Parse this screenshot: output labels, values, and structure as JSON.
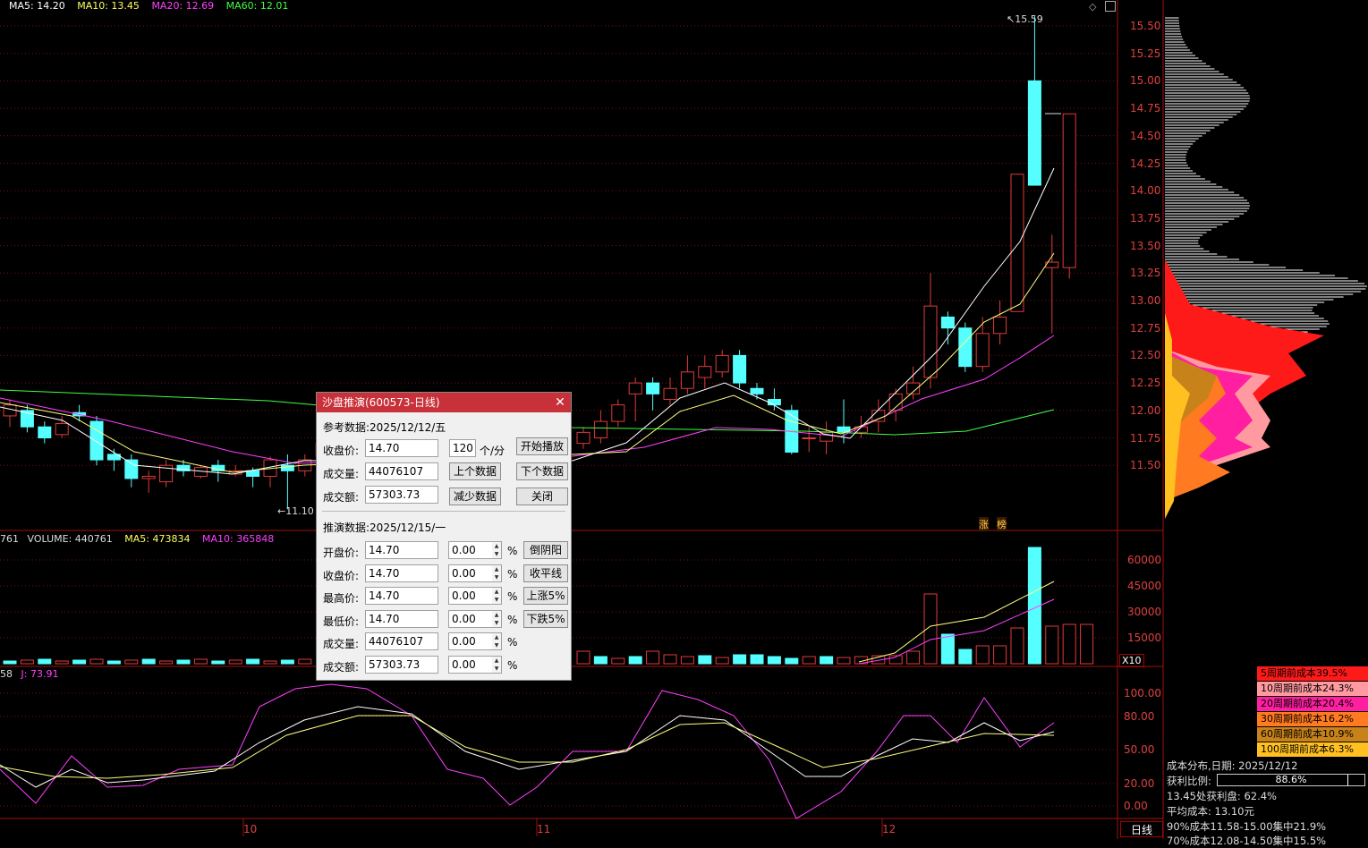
{
  "main_legend": {
    "ma5": "MA5: 14.20",
    "ma10": "MA10: 13.45",
    "ma20": "MA20: 12.69",
    "ma60": "MA60: 12.01"
  },
  "volume_legend": {
    "prefix": "761",
    "volume": "VOLUME: 440761",
    "ma5": "MA5: 473834",
    "ma10": "MA10: 365848"
  },
  "kdj_legend": {
    "prefix": "58",
    "j": "J: 73.91"
  },
  "price_axis": [
    "15.50",
    "15.25",
    "15.00",
    "14.75",
    "14.50",
    "14.25",
    "14.00",
    "13.75",
    "13.50",
    "13.25",
    "13.00",
    "12.75",
    "12.50",
    "12.25",
    "12.00",
    "11.75",
    "11.50"
  ],
  "volume_axis": [
    "60000",
    "45000",
    "30000",
    "15000"
  ],
  "volume_multiplier": "X10",
  "kdj_axis": [
    "100.00",
    "80.00",
    "50.00",
    "20.00",
    "0.00"
  ],
  "month_labels": [
    "10",
    "11",
    "12"
  ],
  "high_marker": "15.59",
  "low_marker": "11.10",
  "tags": [
    "涨",
    "榜"
  ],
  "period_tab": "日线",
  "cost_legend": [
    {
      "label": "5周期前成本39.5%",
      "color": "#ff1a1a"
    },
    {
      "label": "10周期前成本24.3%",
      "color": "#ff9aa0"
    },
    {
      "label": "20周期前成本20.4%",
      "color": "#ff1fa0"
    },
    {
      "label": "30周期前成本16.2%",
      "color": "#ff7a20"
    },
    {
      "label": "60周期前成本10.9%",
      "color": "#c8821a"
    },
    {
      "label": "100周期前成本6.3%",
      "color": "#ffc020"
    }
  ],
  "cost_info": {
    "title": "成本分布,日期: 2025/12/12",
    "profit_label": "获利比例:",
    "profit_value": "88.6%",
    "profit_fraction": 0.886,
    "at_price": "13.45处获利盘: 62.4%",
    "avg_cost": "平均成本: 13.10元",
    "c90": "90%成本11.58-15.00集中21.9%",
    "c70": "70%成本12.08-14.50集中15.5%"
  },
  "dialog": {
    "title": "沙盘推演(600573-日线)",
    "ref_title": "参考数据:2025/12/12/五",
    "close_label": "收盘价:",
    "close_value": "14.70",
    "speed_value": "120",
    "speed_unit": "个/分",
    "play_btn": "开始播放",
    "vol_label": "成交量:",
    "vol_value": "44076107",
    "prev_btn": "上个数据",
    "next_btn": "下个数据",
    "amt_label": "成交额:",
    "amt_value": "57303.73",
    "reduce_btn": "减少数据",
    "close_btn": "关闭",
    "sim_title": "推演数据:2025/12/15/一",
    "rows": [
      {
        "label": "开盘价:",
        "value": "14.70",
        "pct": "0.00",
        "btn": "倒阴阳"
      },
      {
        "label": "收盘价:",
        "value": "14.70",
        "pct": "0.00",
        "btn": "收平线"
      },
      {
        "label": "最高价:",
        "value": "14.70",
        "pct": "0.00",
        "btn": "上涨5%"
      },
      {
        "label": "最低价:",
        "value": "14.70",
        "pct": "0.00",
        "btn": "下跌5%"
      },
      {
        "label": "成交量:",
        "value": "44076107",
        "pct": "0.00",
        "btn": ""
      },
      {
        "label": "成交额:",
        "value": "57303.73",
        "pct": "0.00",
        "btn": ""
      }
    ],
    "pct_sign": "%"
  },
  "colors": {
    "up": "#e03a3a",
    "down": "#55ffff",
    "grid": "#7a1010",
    "ma5": "#ffffff",
    "ma10": "#ffff80",
    "ma20": "#ff40ff",
    "ma60": "#40ff40"
  }
}
